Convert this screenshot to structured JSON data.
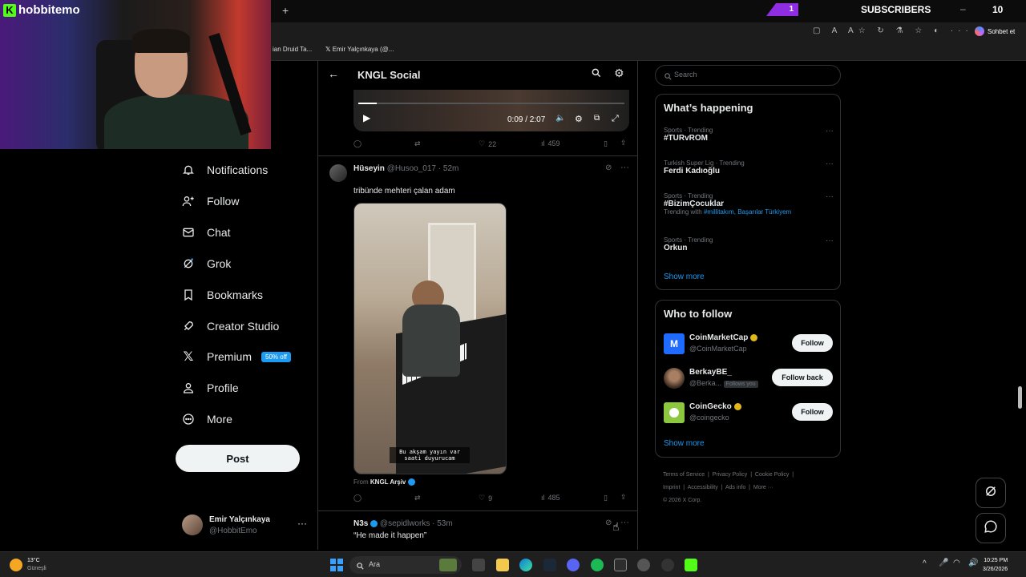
{
  "browser": {
    "new_tab": "+",
    "subscribers_badge": "1",
    "subscribers_label": "SUBSCRIBERS",
    "counter": "10",
    "copilot_label": "Sohbet et",
    "bookmarks": [
      "ian Druid Ta...",
      "Emir Yalçınkaya (@..."
    ]
  },
  "webcam": {
    "brand": "hobbitemo"
  },
  "nav": {
    "items": [
      {
        "label": "Notifications",
        "icon": "bell-icon"
      },
      {
        "label": "Follow",
        "icon": "add-user-icon"
      },
      {
        "label": "Chat",
        "icon": "mail-icon"
      },
      {
        "label": "Grok",
        "icon": "grok-icon"
      },
      {
        "label": "Bookmarks",
        "icon": "bookmark-icon"
      },
      {
        "label": "Creator Studio",
        "icon": "rocket-icon"
      },
      {
        "label": "Premium",
        "icon": "x-logo-icon"
      },
      {
        "label": "Profile",
        "icon": "person-icon"
      },
      {
        "label": "More",
        "icon": "more-circle-icon"
      }
    ],
    "premium_badge": "50% off",
    "post_label": "Post",
    "account": {
      "name": "Emir Yalçınkaya",
      "handle": "@HobbitEmo"
    }
  },
  "header": {
    "title": "KNGL Social"
  },
  "video1": {
    "time": "0:09 / 2:07"
  },
  "post1_actions": {
    "likes": "22",
    "views": "459"
  },
  "post2": {
    "name": "Hüseyin",
    "handle": "@Husoo_017",
    "time": "· 52m",
    "text": "tribünde mehteri çalan adam",
    "subtitle_line1": "Bu akşam yayın var",
    "subtitle_line2": "saati duyurucam",
    "from_label": "From",
    "from_name": "KNGL Arşiv",
    "likes": "9",
    "views": "485"
  },
  "post3": {
    "name": "N3s",
    "handle": "@sepidlworks",
    "time": "· 53m",
    "text": "“He made it happen”"
  },
  "search": {
    "placeholder": "Search"
  },
  "trends": {
    "title": "What’s happening",
    "items": [
      {
        "meta": "Sports · Trending",
        "title": "#TURvROM"
      },
      {
        "meta": "Turkish Super Lig · Trending",
        "title": "Ferdi Kadıoğlu"
      },
      {
        "meta": "Sports · Trending",
        "title": "#BizimÇocuklar",
        "with_label": "Trending with",
        "with_tags": "#millitakım, Başarılar Türkiyem"
      },
      {
        "meta": "Sports · Trending",
        "title": "Orkun"
      }
    ],
    "show_more": "Show more"
  },
  "who_to_follow": {
    "title": "Who to follow",
    "items": [
      {
        "name": "CoinMarketCap",
        "handle": "@CoinMarketCap",
        "button": "Follow"
      },
      {
        "name": "BerkayBE_",
        "handle": "@Berka...",
        "follows_you": "Follows you",
        "button": "Follow back"
      },
      {
        "name": "CoinGecko",
        "handle": "@coingecko",
        "button": "Follow"
      }
    ],
    "show_more": "Show more"
  },
  "footer": {
    "links1": [
      "Terms of Service",
      "Privacy Policy",
      "Cookie Policy"
    ],
    "links2": [
      "Imprint",
      "Accessibility",
      "Ads info",
      "More ···"
    ],
    "copyright": "© 2026 X Corp."
  },
  "taskbar": {
    "weather_temp": "13°C",
    "weather_desc": "Güneşli",
    "search_placeholder": "Ara",
    "time": "10:25 PM",
    "date": "3/26/2026"
  }
}
